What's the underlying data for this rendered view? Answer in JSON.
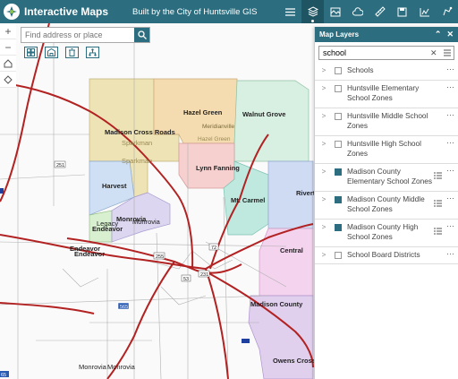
{
  "header": {
    "title": "Interactive Maps",
    "subtitle": "Built by the City of Huntsville GIS",
    "tools": [
      "list-icon",
      "layers-icon",
      "basemap-icon",
      "cloud-icon",
      "measure-icon",
      "print-icon",
      "chart-icon",
      "share-icon"
    ]
  },
  "search": {
    "placeholder": "Find address or place"
  },
  "map_labels": {
    "hazel_green": "Hazel Green",
    "meridianville": "Meridianville",
    "walnut_grove": "Walnut Grove",
    "madison_cross_roads": "Madison Cross Roads",
    "sparkman_1": "Sparkman",
    "sparkman_2": "Sparkman",
    "hazel_green_small": "Hazel Green",
    "lynn_fanning": "Lynn Fanning",
    "harvest": "Harvest",
    "mt_carmel": "Mt. Carmel",
    "riverton": "Riverto",
    "monrovia": "Monrovia",
    "legacy": "Legacy",
    "monrovia_2": "Monrovia",
    "endeavor_1": "Endeavor",
    "endeavor_2": "Endeavor",
    "endeavor_3": "Endeavor",
    "central": "Central",
    "madison_county": "Madison County",
    "monrovia_3": "Monrovia",
    "monrovia_4": "Monrovia",
    "owens_cross": "Owens Cross Ro",
    "r251": "251",
    "r255": "255",
    "r72": "72",
    "r231": "231",
    "r53": "53",
    "r565": "565",
    "r65": "65"
  },
  "panel": {
    "title": "Map Layers",
    "filter_value": "school",
    "layers": [
      {
        "label": "Schools",
        "checked": false,
        "legend": false
      },
      {
        "label": "Huntsville Elementary School Zones",
        "checked": false,
        "legend": false
      },
      {
        "label": "Huntsville Middle School Zones",
        "checked": false,
        "legend": false
      },
      {
        "label": "Huntsville High School Zones",
        "checked": false,
        "legend": false
      },
      {
        "label": "Madison County Elementary School Zones",
        "checked": true,
        "legend": true
      },
      {
        "label": "Madison County Middle School Zones",
        "checked": true,
        "legend": true
      },
      {
        "label": "Madison County High School Zones",
        "checked": true,
        "legend": true
      },
      {
        "label": "School Board Districts",
        "checked": false,
        "legend": false
      }
    ]
  },
  "colors": {
    "header": "#2c6e7f",
    "highway": "#b22222",
    "zone_madison_cross_roads": "#ede3b5",
    "zone_hazel_green": "#f4dcb0",
    "zone_walnut_grove": "#d8f0e2",
    "zone_lynn_fanning": "#f6cfcf",
    "zone_harvest": "#cfe0f4",
    "zone_mt_carmel": "#bfe8df",
    "zone_riverton": "#cfdbf2",
    "zone_central": "#f3d3ee",
    "zone_madison_county": "#e0d0ee"
  }
}
